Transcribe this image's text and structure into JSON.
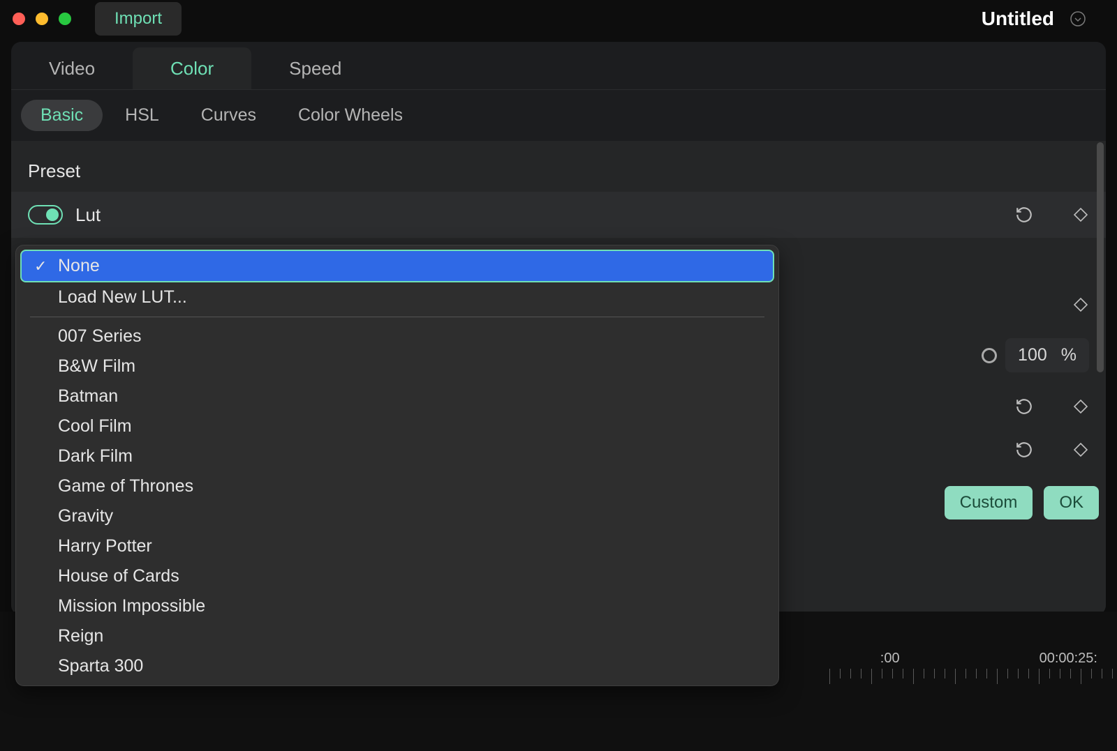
{
  "title_bar": {
    "import_label": "Import",
    "title": "Untitled"
  },
  "main_tabs": [
    {
      "label": "Video",
      "active": false
    },
    {
      "label": "Color",
      "active": true
    },
    {
      "label": "Speed",
      "active": false
    }
  ],
  "sub_tabs": [
    {
      "label": "Basic",
      "active": true
    },
    {
      "label": "HSL",
      "active": false
    },
    {
      "label": "Curves",
      "active": false
    },
    {
      "label": "Color Wheels",
      "active": false
    }
  ],
  "preset": {
    "heading": "Preset",
    "lut_label": "Lut",
    "lut_enabled": true
  },
  "value_display": {
    "value": "100",
    "unit": "%"
  },
  "buttons": {
    "custom": "Custom",
    "ok": "OK"
  },
  "lut_dropdown": {
    "selected_index": 0,
    "top_items": [
      "None",
      "Load New LUT..."
    ],
    "presets": [
      "007 Series",
      "B&W Film",
      "Batman",
      "Cool Film",
      "Dark Film",
      "Game of Thrones",
      "Gravity",
      "Harry Potter",
      "House of Cards",
      "Mission Impossible",
      "Reign",
      "Sparta 300"
    ]
  },
  "timeline": {
    "times": [
      ":00",
      "00:00:25:"
    ]
  }
}
